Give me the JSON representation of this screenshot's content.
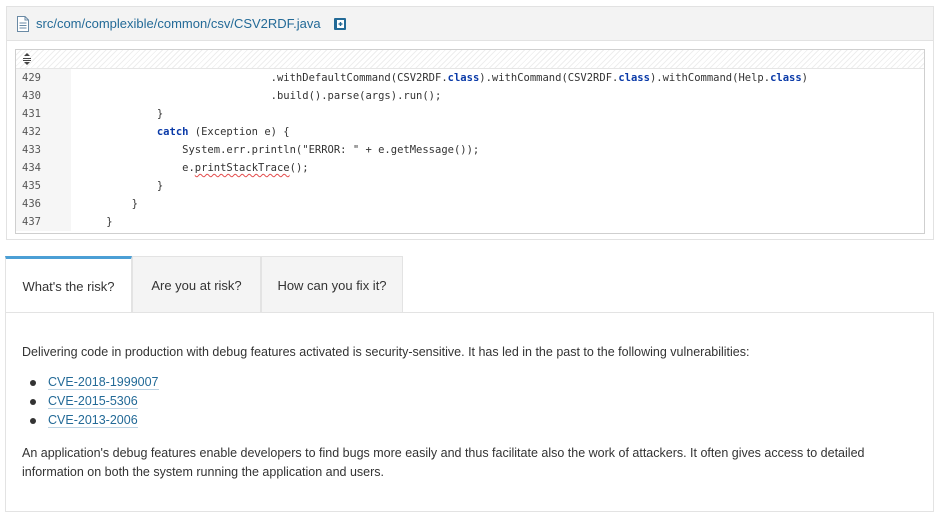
{
  "file": {
    "path": "src/com/complexible/common/csv/CSV2RDF.java",
    "file_icon": "document-icon",
    "copy_icon": "clipboard-icon"
  },
  "code": {
    "expand_icon": "expand-icon",
    "lines": [
      {
        "num": "429",
        "segments": [
          {
            "t": "                              .withDefaultCommand(CSV2RDF.",
            "c": ""
          },
          {
            "t": "class",
            "c": "kw"
          },
          {
            "t": ").withCommand(CSV2RDF.",
            "c": ""
          },
          {
            "t": "class",
            "c": "kw"
          },
          {
            "t": ").withCommand(Help.",
            "c": ""
          },
          {
            "t": "class",
            "c": "kw"
          },
          {
            "t": ")",
            "c": ""
          }
        ]
      },
      {
        "num": "430",
        "segments": [
          {
            "t": "                              .build().parse(args).run();",
            "c": ""
          }
        ]
      },
      {
        "num": "431",
        "segments": [
          {
            "t": "            }",
            "c": ""
          }
        ]
      },
      {
        "num": "432",
        "segments": [
          {
            "t": "            ",
            "c": ""
          },
          {
            "t": "catch",
            "c": "kw"
          },
          {
            "t": " (Exception e) {",
            "c": ""
          }
        ]
      },
      {
        "num": "433",
        "segments": [
          {
            "t": "                System.err.println(\"ERROR: \" + e.getMessage());",
            "c": ""
          }
        ]
      },
      {
        "num": "434",
        "segments": [
          {
            "t": "                e.",
            "c": ""
          },
          {
            "t": "printStackTrace",
            "c": "squiggle"
          },
          {
            "t": "();",
            "c": ""
          }
        ]
      },
      {
        "num": "435",
        "segments": [
          {
            "t": "            }",
            "c": ""
          }
        ]
      },
      {
        "num": "436",
        "segments": [
          {
            "t": "        }",
            "c": ""
          }
        ]
      },
      {
        "num": "437",
        "segments": [
          {
            "t": "    }",
            "c": ""
          }
        ]
      }
    ]
  },
  "tabs": [
    {
      "label": "What's the risk?",
      "active": true
    },
    {
      "label": "Are you at risk?",
      "active": false
    },
    {
      "label": "How can you fix it?",
      "active": false
    }
  ],
  "risk": {
    "intro": "Delivering code in production with debug features activated is security-sensitive. It has led in the past to the following vulnerabilities:",
    "cves": [
      "CVE-2018-1999007",
      "CVE-2015-5306",
      "CVE-2013-2006"
    ],
    "outro": "An application's debug features enable developers to find bugs more easily and thus facilitate also the work of attackers. It often gives access to detailed information on both the system running the application and users."
  },
  "colors": {
    "link": "#236a97",
    "keyword": "#0a3aa8",
    "active_tab_accent": "#4b9fd5",
    "squiggle": "#e34b4b"
  }
}
